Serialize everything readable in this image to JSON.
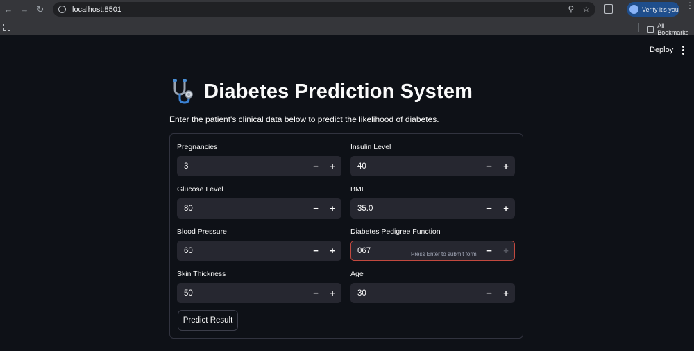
{
  "browser": {
    "url": "localhost:8501",
    "verify_label": "Verify it's you",
    "bookmarks_label": "All Bookmarks"
  },
  "app": {
    "deploy_label": "Deploy",
    "title": "Diabetes Prediction System",
    "subtitle": "Enter the patient's clinical data below to predict the likelihood of diabetes.",
    "fields": {
      "pregnancies": {
        "label": "Pregnancies",
        "value": "3"
      },
      "insulin": {
        "label": "Insulin Level",
        "value": "40"
      },
      "glucose": {
        "label": "Glucose Level",
        "value": "80"
      },
      "bmi": {
        "label": "BMI",
        "value": "35.0"
      },
      "blood_pressure": {
        "label": "Blood Pressure",
        "value": "60"
      },
      "dpf": {
        "label": "Diabetes Pedigree Function",
        "value": "067",
        "hint": "Press Enter to submit form"
      },
      "skin": {
        "label": "Skin Thickness",
        "value": "50"
      },
      "age": {
        "label": "Age",
        "value": "30"
      }
    },
    "stepper": {
      "minus": "−",
      "plus": "+"
    },
    "submit_label": "Predict Result"
  }
}
